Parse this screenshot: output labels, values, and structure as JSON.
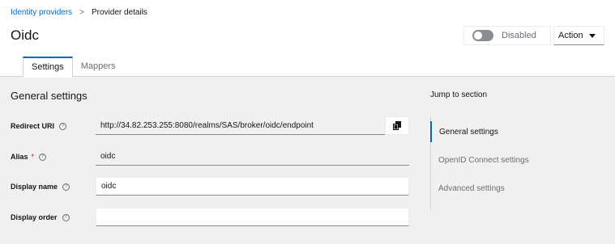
{
  "breadcrumb": {
    "parent": "Identity providers",
    "separator": ">",
    "current": "Provider details"
  },
  "page_title": "Oidc",
  "toggle": {
    "label": "Disabled",
    "enabled": false
  },
  "action_dropdown": {
    "label": "Action"
  },
  "tabs": [
    {
      "label": "Settings",
      "active": true
    },
    {
      "label": "Mappers",
      "active": false
    }
  ],
  "general_settings": {
    "title": "General settings",
    "fields": {
      "redirect_uri": {
        "label": "Redirect URI",
        "value": "http://34.82.253.255:8080/realms/SAS/broker/oidc/endpoint",
        "required": false
      },
      "alias": {
        "label": "Alias",
        "value": "oidc",
        "required": true,
        "required_mark": "*"
      },
      "display_name": {
        "label": "Display name",
        "value": "oidc",
        "required": false
      },
      "display_order": {
        "label": "Display order",
        "value": "",
        "required": false
      }
    },
    "help_glyph": "?"
  },
  "jump_to_section": {
    "title": "Jump to section",
    "items": [
      {
        "label": "General settings",
        "active": true
      },
      {
        "label": "OpenID Connect settings",
        "active": false
      },
      {
        "label": "Advanced settings",
        "active": false
      }
    ]
  },
  "colors": {
    "accent": "#0066cc",
    "required": "#c9190b",
    "switch_off": "#8a8d90"
  },
  "icons": [
    "help-icon",
    "copy-icon",
    "caret-down-icon"
  ]
}
